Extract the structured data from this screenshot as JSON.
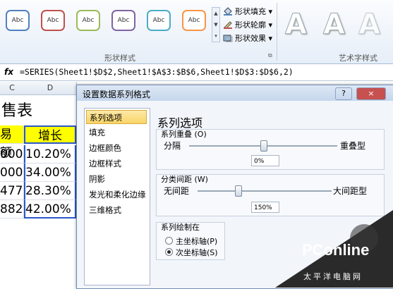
{
  "ribbon": {
    "shape_styles": [
      {
        "label": "Abc",
        "color": "#4f81bd"
      },
      {
        "label": "Abc",
        "color": "#c0504d"
      },
      {
        "label": "Abc",
        "color": "#9bbb59"
      },
      {
        "label": "Abc",
        "color": "#8064a2"
      },
      {
        "label": "Abc",
        "color": "#4bacc6"
      },
      {
        "label": "Abc",
        "color": "#f79646"
      }
    ],
    "fill_label": "形状填充",
    "outline_label": "形状轮廓",
    "effects_label": "形状效果",
    "shape_styles_group": "形状样式",
    "wordart_group": "艺术字样式",
    "wordart_samples": [
      "A",
      "A",
      "A"
    ]
  },
  "formula_bar": {
    "fx": "fx",
    "formula": "=SERIES(Sheet1!$D$2,Sheet1!$A$3:$B$6,Sheet1!$D$3:$D$6,2)"
  },
  "sheet": {
    "col_c": "C",
    "col_d": "D",
    "title": "售表",
    "header_c": "易额",
    "header_d": "增长",
    "rows": [
      {
        "c": "000",
        "d": "10.20%"
      },
      {
        "c": "000",
        "d": "34.00%"
      },
      {
        "c": "477",
        "d": "28.30%"
      },
      {
        "c": "882",
        "d": "42.00%"
      }
    ]
  },
  "dialog": {
    "title": "设置数据系列格式",
    "help": "?",
    "close": "×",
    "nav": [
      "系列选项",
      "填充",
      "边框颜色",
      "边框样式",
      "阴影",
      "发光和柔化边缘",
      "三维格式"
    ],
    "section_title": "系列选项",
    "overlap": {
      "label": "系列重叠",
      "hotkey": "(O)",
      "left": "分隔",
      "right": "重叠型",
      "value": "0%",
      "position": 0.5
    },
    "gap": {
      "label": "分类间距",
      "hotkey": "(W)",
      "left": "无间距",
      "right": "大间距型",
      "value": "150%",
      "position": 0.3
    },
    "plot_on": {
      "label": "系列绘制在",
      "primary": "主坐标轴",
      "primary_key": "(P)",
      "secondary": "次坐标轴",
      "secondary_key": "(S)",
      "selected": "secondary"
    }
  },
  "watermark": {
    "brand": "PConline",
    "sub": "太平洋电脑网"
  }
}
